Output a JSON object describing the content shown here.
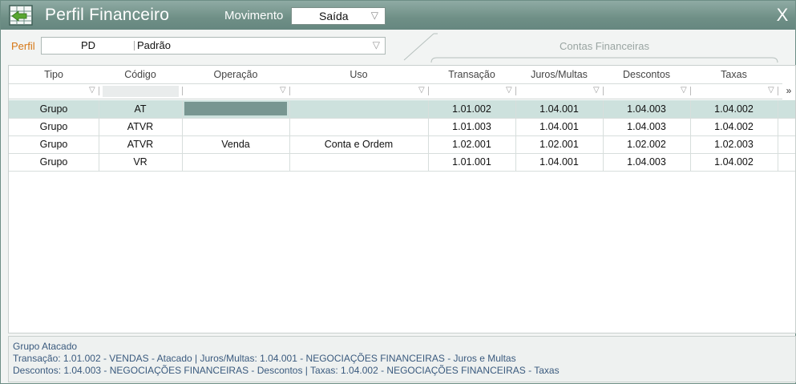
{
  "window": {
    "title": "Perfil Financeiro",
    "movimento_label": "Movimento",
    "movimento_value": "Saída",
    "close_glyph": "X"
  },
  "perfil": {
    "label": "Perfil",
    "code": "PD",
    "name": "Padrão"
  },
  "contas_title": "Contas Financeiras",
  "columns": [
    "Tipo",
    "Código",
    "Operação",
    "Uso",
    "Transação",
    "Juros/Multas",
    "Descontos",
    "Taxas"
  ],
  "rows": [
    {
      "tipo": "Grupo",
      "codigo": "AT",
      "operacao": "",
      "uso": "",
      "transacao": "1.01.002",
      "juros": "1.04.001",
      "descontos": "1.04.003",
      "taxas": "1.04.002",
      "selected": true
    },
    {
      "tipo": "Grupo",
      "codigo": "ATVR",
      "operacao": "",
      "uso": "",
      "transacao": "1.01.003",
      "juros": "1.04.001",
      "descontos": "1.04.003",
      "taxas": "1.04.002",
      "selected": false
    },
    {
      "tipo": "Grupo",
      "codigo": "ATVR",
      "operacao": "Venda",
      "uso": "Conta e Ordem",
      "transacao": "1.02.001",
      "juros": "1.02.001",
      "descontos": "1.02.002",
      "taxas": "1.02.003",
      "selected": false
    },
    {
      "tipo": "Grupo",
      "codigo": "VR",
      "operacao": "",
      "uso": "",
      "transacao": "1.01.001",
      "juros": "1.04.001",
      "descontos": "1.04.003",
      "taxas": "1.04.002",
      "selected": false
    }
  ],
  "status": {
    "line1": "Grupo Atacado",
    "line2": "Transação: 1.01.002 - VENDAS - Atacado    |    Juros/Multas: 1.04.001 - NEGOCIAÇÕES FINANCEIRAS - Juros e Multas",
    "line3": "Descontos: 1.04.003 - NEGOCIAÇÕES FINANCEIRAS - Descontos    |    Taxas: 1.04.002 - NEGOCIAÇÕES FINANCEIRAS - Taxas"
  },
  "colors": {
    "titlebar": "#6f8f86",
    "selected_row": "#cde1dd",
    "perfil_label": "#d67716",
    "status_text": "#3a5a7e"
  }
}
